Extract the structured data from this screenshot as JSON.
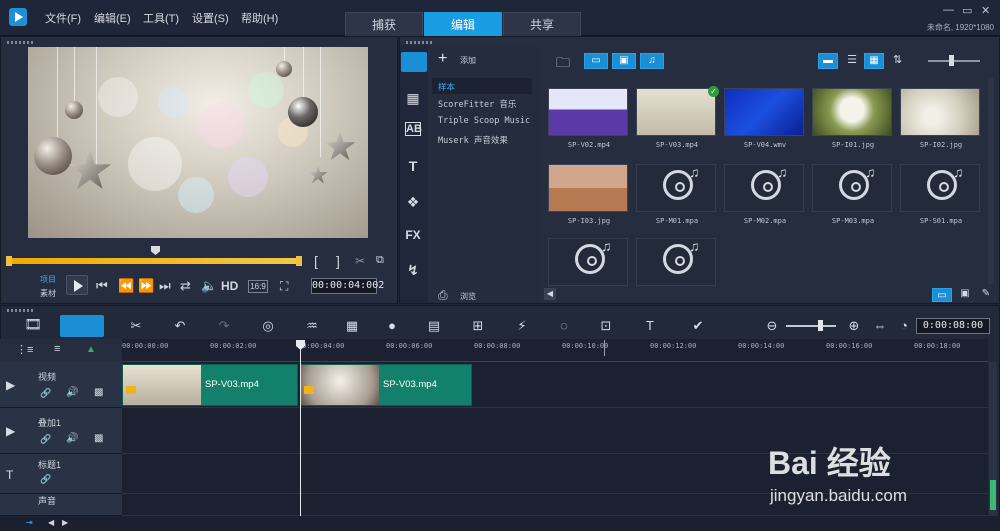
{
  "menu": [
    "文件(F)",
    "编辑(E)",
    "工具(T)",
    "设置(S)",
    "帮助(H)"
  ],
  "tabs": [
    "捕获",
    "编辑",
    "共享"
  ],
  "active_tab": "编辑",
  "window": {
    "minimize": "—",
    "restore": "▭",
    "close": "✕",
    "project_info": "未命名, 1920*1080"
  },
  "preview": {
    "mode_project": "项目",
    "mode_clip": "素材",
    "hd": "HD",
    "aspect": "16:9",
    "timecode": "00:00:04:002",
    "mark_in": "[",
    "mark_out": "]"
  },
  "library": {
    "add_label": "添加",
    "browse_label": "浏览",
    "categories": [
      "样本",
      "ScoreFitter 音乐",
      "Triple Scoop Music",
      "Muserk 声音效果"
    ],
    "selected_category": "样本",
    "side_icons": [
      "media-icon",
      "transition-icon",
      "title-ab-icon",
      "text-icon",
      "graphics-icon",
      "fx-icon",
      "path-icon"
    ],
    "fx_label": "FX",
    "items": [
      {
        "name": "SP-V02.mp4",
        "kind": "video1"
      },
      {
        "name": "SP-V03.mp4",
        "kind": "video2",
        "checked": true
      },
      {
        "name": "SP-V04.wmv",
        "kind": "video3"
      },
      {
        "name": "SP-I01.jpg",
        "kind": "dandelion"
      },
      {
        "name": "SP-I02.jpg",
        "kind": "dandelion2"
      },
      {
        "name": "SP-I03.jpg",
        "kind": "desert"
      },
      {
        "name": "SP-M01.mpa",
        "kind": "audio"
      },
      {
        "name": "SP-M02.mpa",
        "kind": "audio"
      },
      {
        "name": "SP-M03.mpa",
        "kind": "audio"
      },
      {
        "name": "SP-S01.mpa",
        "kind": "audio"
      },
      {
        "name": "",
        "kind": "audio"
      },
      {
        "name": "",
        "kind": "audio"
      }
    ]
  },
  "timeline": {
    "timecode": "0:00:08:00",
    "ruler": [
      "00:00:00:00",
      "00:00:02:00",
      "00:00:04:00",
      "00:00:06:00",
      "00:00:08:00",
      "00:00:10:00",
      "00:00:12:00",
      "00:00:14:00",
      "00:00:16:00",
      "00:00:18:00"
    ],
    "tracks": [
      "视频",
      "叠加1",
      "标题1",
      "声音"
    ],
    "clips": [
      {
        "label": "SP-V03.mp4",
        "track": "视频"
      },
      {
        "label": "SP-V03.mp4",
        "track": "视频"
      }
    ]
  },
  "watermark": {
    "brand": "Bai 经验",
    "url": "jingyan.baidu.com"
  }
}
